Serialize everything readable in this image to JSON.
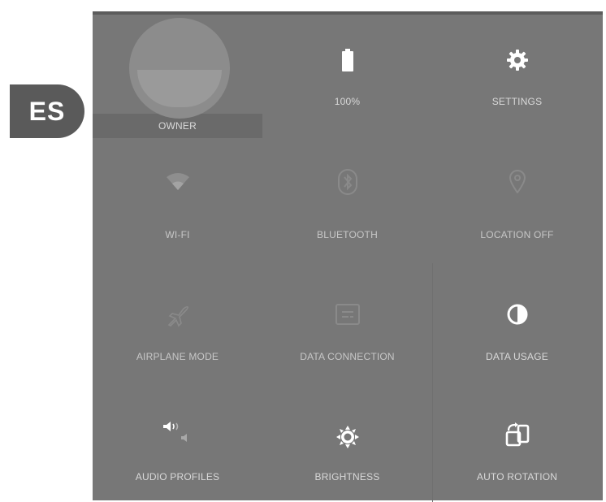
{
  "language_tab": {
    "code": "ES"
  },
  "quick_settings": {
    "tiles": [
      {
        "label": "OWNER",
        "icon": "avatar-icon",
        "enabled": true
      },
      {
        "label": "100%",
        "icon": "battery-icon",
        "enabled": true
      },
      {
        "label": "SETTINGS",
        "icon": "gear-icon",
        "enabled": true
      },
      {
        "label": "WI-FI",
        "icon": "wifi-icon",
        "enabled": false
      },
      {
        "label": "BLUETOOTH",
        "icon": "bluetooth-icon",
        "enabled": false
      },
      {
        "label": "LOCATION OFF",
        "icon": "location-icon",
        "enabled": false
      },
      {
        "label": "AIRPLANE MODE",
        "icon": "airplane-icon",
        "enabled": false
      },
      {
        "label": "DATA CONNECTION",
        "icon": "data-connection-icon",
        "enabled": false
      },
      {
        "label": "DATA USAGE",
        "icon": "data-usage-icon",
        "enabled": true
      },
      {
        "label": "AUDIO PROFILES",
        "icon": "audio-profiles-icon",
        "enabled": true
      },
      {
        "label": "BRIGHTNESS",
        "icon": "brightness-icon",
        "enabled": true
      },
      {
        "label": "AUTO ROTATION",
        "icon": "auto-rotation-icon",
        "enabled": true
      }
    ]
  },
  "colors": {
    "panel": "#777777",
    "tab": "#5a5a5a",
    "icon_active": "#ffffff",
    "icon_dim": "#8e8e8e"
  }
}
